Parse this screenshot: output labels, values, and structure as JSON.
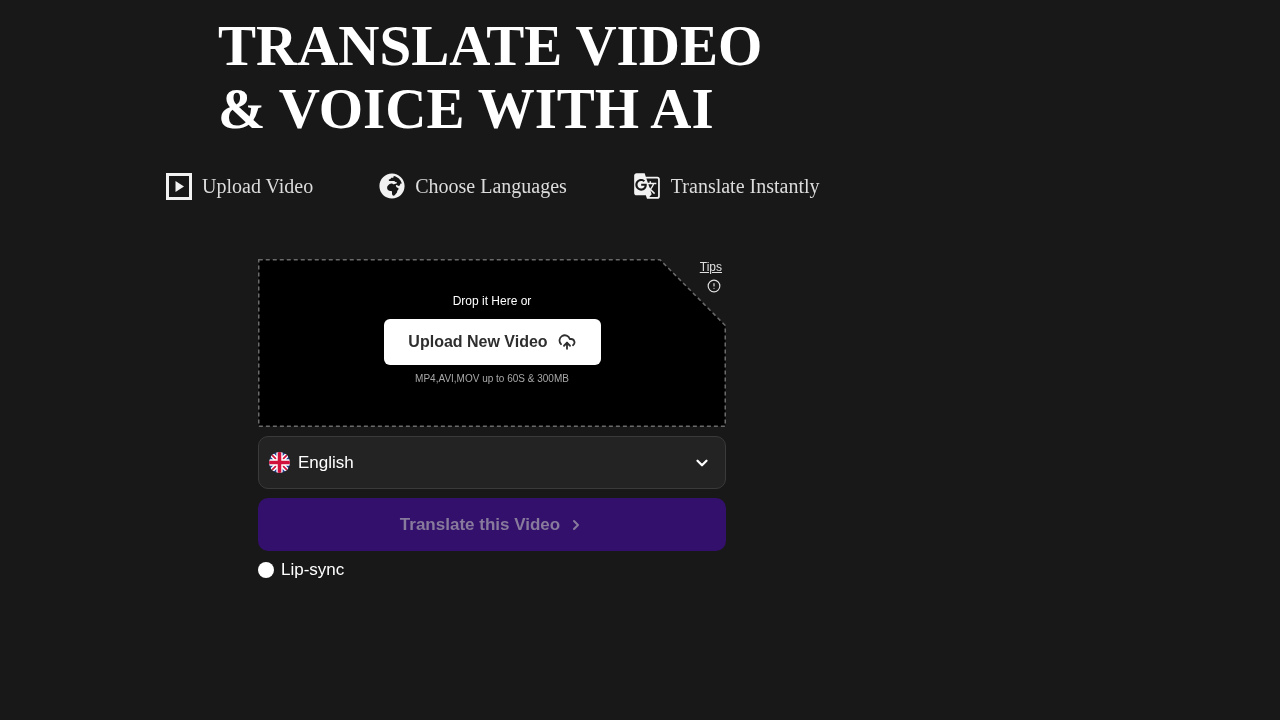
{
  "title": "TRANSLATE VIDEO & VOICE WITH AI",
  "steps": [
    {
      "kind": "video",
      "label": "Upload Video"
    },
    {
      "kind": "globe",
      "label": "Choose Languages"
    },
    {
      "kind": "translate",
      "label": "Translate Instantly"
    }
  ],
  "upload": {
    "tips": "Tips",
    "prompt": "Drop it Here or",
    "button": "Upload New Video",
    "formats": "MP4,AVI,MOV up to 60S & 300MB"
  },
  "language_select": {
    "value": "English"
  },
  "translate_button": {
    "label": "Translate this Video",
    "disabled": true
  },
  "lip_sync": {
    "label": "Lip-sync",
    "checked": false
  }
}
